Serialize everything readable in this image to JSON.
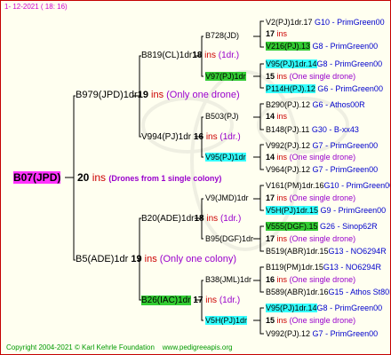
{
  "date_stamp": "1- 12-2021 ( 18: 16)",
  "footer": {
    "copyright": "Copyright 2004-2021 © Karl Kehrle Foundation",
    "site": "www.pedigreeapis.org"
  },
  "root": {
    "id": "B07(JPD)",
    "inbreeding": "20",
    "ins": "ins",
    "note": "(Drones from 1 single colony)"
  },
  "gen1": [
    {
      "id": "B979(JPD)1dr",
      "inbreeding": "19",
      "ins": "ins",
      "note": "(Only one drone)"
    },
    {
      "id": "B5(ADE)1dr",
      "inbreeding": "19",
      "ins": "ins",
      "note": "(Only one colony)"
    }
  ],
  "gen2": [
    {
      "id": "B819(CL)1dr",
      "inbreeding": "18",
      "ins": "ins",
      "note": "(1dr.)"
    },
    {
      "id": "V994(PJ)1dr",
      "inbreeding": "16",
      "ins": "ins",
      "note": "(1dr.)"
    },
    {
      "id": "B20(ADE)1dr",
      "inbreeding": "18",
      "ins": "ins",
      "note": "(1dr.)"
    },
    {
      "id": "B26(IAC)1dr",
      "inbreeding": "17",
      "ins": "ins",
      "note": "(1dr.)"
    }
  ],
  "gen3": [
    {
      "id": "B728(JD)"
    },
    {
      "id": "V97(PJ)1dr",
      "inbreeding": "15",
      "ins": "ins",
      "note": "(One single drone)"
    },
    {
      "id": "B503(PJ)"
    },
    {
      "id": "V95(PJ)1dr",
      "inbreeding": "14",
      "ins": "ins",
      "note": "(One single drone)"
    },
    {
      "id": "V9(JMD)1dr",
      "inbreeding": "17",
      "ins": "ins",
      "note": "(One single drone)"
    },
    {
      "id": "B95(DGF)1dr",
      "inbreeding": "17",
      "ins": "ins",
      "note": "(One single drone)"
    },
    {
      "id": "B38(JML)1dr",
      "inbreeding": "16",
      "ins": "ins",
      "note": "(One single drone)"
    },
    {
      "id": "V5H(PJ)1dr",
      "inbreeding": "15",
      "ins": "ins",
      "note": "(One single drone)"
    }
  ],
  "gen4": [
    {
      "id": "V2(PJ)1dr.17",
      "code": "G10",
      "line": "PrimGreen00"
    },
    {
      "id": "17",
      "ins": "ins"
    },
    {
      "id": "V216(PJ).13",
      "code": "G8",
      "line": "PrimGreen00"
    },
    {
      "id": "V95(PJ)1dr.14",
      "code": "G8",
      "line": "PrimGreen00"
    },
    {
      "id": "P114H(PJ).12",
      "code": "G6",
      "line": "PrimGreen00"
    },
    {
      "id": "B290(PJ).12",
      "code": "G6",
      "line": "Athos00R"
    },
    {
      "id": "14",
      "ins": "ins"
    },
    {
      "id": "B148(PJ).11",
      "code": "G30",
      "line": "B-xx43"
    },
    {
      "id": "V992(PJ).12",
      "code": "G7",
      "line": "PrimGreen00"
    },
    {
      "id": "V964(PJ).12",
      "code": "G7",
      "line": "PrimGreen00"
    },
    {
      "id": "V161(PM)1dr.16",
      "code": "G10",
      "line": "PrimGreen00"
    },
    {
      "id": "V5H(PJ)1dr.15",
      "code": "G9",
      "line": "PrimGreen00"
    },
    {
      "id": "V555(DGF).15",
      "code": "G26",
      "line": "Sinop62R"
    },
    {
      "id": "B519(ABR)1dr.15",
      "code": "G13",
      "line": "NO6294R"
    },
    {
      "id": "B119(PM)1dr.15",
      "code": "G13",
      "line": "NO6294R"
    },
    {
      "id": "B589(ABR)1dr.16",
      "code": "G15",
      "line": "Athos St80R"
    },
    {
      "id": "V95(PJ)1dr.14",
      "code": "G8",
      "line": "PrimGreen00"
    },
    {
      "id": "V992(PJ).12",
      "code": "G7",
      "line": "PrimGreen00"
    }
  ],
  "colors": {
    "border": "#c40000",
    "background": "#fffff0",
    "magenta": "#ff33ff",
    "green": "#33cc33",
    "cyan": "#33ffff",
    "red": "#cc0000",
    "blue": "#0000cc"
  }
}
